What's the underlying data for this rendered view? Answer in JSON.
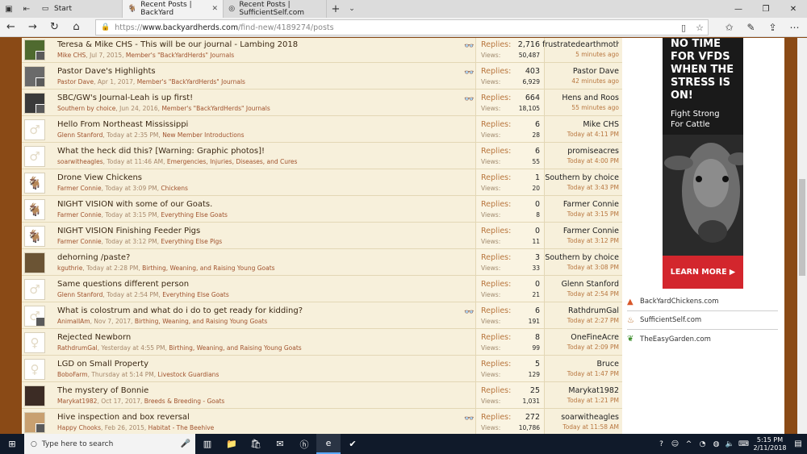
{
  "browser": {
    "tabs": [
      {
        "label": "Start",
        "state": "start"
      },
      {
        "label": "Recent Posts | BackYard",
        "state": "active"
      },
      {
        "label": "Recent Posts | SufficientSelf.com",
        "state": "inactive"
      }
    ],
    "url": {
      "prefix": "https://",
      "domain": "www.backyardherds.com",
      "path": "/find-new/4189274/posts"
    }
  },
  "labels": {
    "replies": "Replies:",
    "views": "Views:"
  },
  "threads": [
    {
      "title": "Teresa & Mike CHS - This will be our journal - Lambing 2018",
      "author": "Mike CHS",
      "date": "Jul 7, 2015",
      "forum": "Member's \"BackYardHerds\" Journals",
      "replies": "2,716",
      "views": "50,487",
      "last_user": "frustratedearthmother",
      "last_time": "5 minutes ago",
      "avatar": "photo-green",
      "watched": true
    },
    {
      "title": "Pastor Dave's Highlights",
      "author": "Pastor Dave",
      "date": "Apr 1, 2017",
      "forum": "Member's \"BackYardHerds\" Journals",
      "replies": "403",
      "views": "6,929",
      "last_user": "Pastor Dave",
      "last_time": "42 minutes ago",
      "avatar": "photo-gray",
      "watched": true
    },
    {
      "title": "SBC/GW's Journal-Leah is up first!",
      "author": "Southern by choice",
      "date": "Jun 24, 2016",
      "forum": "Member's \"BackYardHerds\" Journals",
      "replies": "664",
      "views": "18,105",
      "last_user": "Hens and Roos",
      "last_time": "55 minutes ago",
      "avatar": "photo-dog",
      "watched": true
    },
    {
      "title": "Hello From Northeast Mississippi",
      "author": "Glenn Stanford",
      "date": "Today at 2:35 PM",
      "forum": "New Member Introductions",
      "replies": "6",
      "views": "28",
      "last_user": "Mike CHS",
      "last_time": "Today at 4:11 PM",
      "avatar": "male",
      "watched": false
    },
    {
      "title": "What the heck did this? [Warning: Graphic photos]!",
      "author": "soarwitheagles",
      "date": "Today at 11:46 AM",
      "forum": "Emergencies, Injuries, Diseases, and Cures",
      "replies": "6",
      "views": "55",
      "last_user": "promiseacres",
      "last_time": "Today at 4:00 PM",
      "avatar": "male",
      "watched": false
    },
    {
      "title": "Drone View Chickens",
      "author": "Farmer Connie",
      "date": "Today at 3:09 PM",
      "forum": "Chickens",
      "replies": "1",
      "views": "20",
      "last_user": "Southern by choice",
      "last_time": "Today at 3:43 PM",
      "avatar": "goat",
      "watched": false
    },
    {
      "title": "NIGHT VISION with some of our Goats.",
      "author": "Farmer Connie",
      "date": "Today at 3:15 PM",
      "forum": "Everything Else Goats",
      "replies": "0",
      "views": "8",
      "last_user": "Farmer Connie",
      "last_time": "Today at 3:15 PM",
      "avatar": "goat",
      "watched": false
    },
    {
      "title": "NIGHT VISION Finishing Feeder Pigs",
      "author": "Farmer Connie",
      "date": "Today at 3:12 PM",
      "forum": "Everything Else Pigs",
      "replies": "0",
      "views": "11",
      "last_user": "Farmer Connie",
      "last_time": "Today at 3:12 PM",
      "avatar": "goat",
      "watched": false
    },
    {
      "title": "dehorning /paste?",
      "author": "kguthrie",
      "date": "Today at 2:28 PM",
      "forum": "Birthing, Weaning, and Raising Young Goats",
      "replies": "3",
      "views": "33",
      "last_user": "Southern by choice",
      "last_time": "Today at 3:08 PM",
      "avatar": "photo-brown",
      "watched": false
    },
    {
      "title": "Same questions different person",
      "author": "Glenn Stanford",
      "date": "Today at 2:54 PM",
      "forum": "Everything Else Goats",
      "replies": "0",
      "views": "21",
      "last_user": "Glenn Stanford",
      "last_time": "Today at 2:54 PM",
      "avatar": "male",
      "watched": false
    },
    {
      "title": "What is colostrum and what do i do to get ready for kidding?",
      "author": "AnimalIAm",
      "date": "Nov 7, 2017",
      "forum": "Birthing, Weaning, and Raising Young Goats",
      "replies": "6",
      "views": "191",
      "last_user": "RathdrumGal",
      "last_time": "Today at 2:27 PM",
      "avatar": "male-mini",
      "watched": true
    },
    {
      "title": "Rejected Newborn",
      "author": "RathdrumGal",
      "date": "Yesterday at 4:55 PM",
      "forum": "Birthing, Weaning, and Raising Young Goats",
      "replies": "8",
      "views": "99",
      "last_user": "OneFineAcre",
      "last_time": "Today at 2:09 PM",
      "avatar": "female",
      "watched": false
    },
    {
      "title": "LGD on Small Property",
      "author": "BoboFarm",
      "date": "Thursday at 5:14 PM",
      "forum": "Livestock Guardians",
      "replies": "5",
      "views": "129",
      "last_user": "Bruce",
      "last_time": "Today at 1:47 PM",
      "avatar": "female",
      "watched": false
    },
    {
      "title": "The mystery of Bonnie",
      "author": "Marykat1982",
      "date": "Oct 17, 2017",
      "forum": "Breeds & Breeding - Goats",
      "replies": "25",
      "views": "1,031",
      "last_user": "Marykat1982",
      "last_time": "Today at 1:21 PM",
      "avatar": "photo-person",
      "watched": false
    },
    {
      "title": "Hive inspection and box reversal",
      "author": "Happy Chooks",
      "date": "Feb 26, 2015",
      "forum": "Habitat - The Beehive",
      "replies": "272",
      "views": "10,786",
      "last_user": "soarwitheagles",
      "last_time": "Today at 11:58 AM",
      "avatar": "photo-tan",
      "watched": true
    }
  ],
  "ad": {
    "headline": "NO TIME FOR VFDS WHEN THE STRESS IS ON!",
    "sub1": "Fight Strong",
    "sub2": "For Cattle",
    "cta": "LEARN MORE ▶"
  },
  "sister_sites": [
    {
      "label": "BackYardChickens.com",
      "icon": "chicken-icon"
    },
    {
      "label": "SufficientSelf.com",
      "icon": "flame-icon"
    },
    {
      "label": "TheEasyGarden.com",
      "icon": "leaf-icon"
    }
  ],
  "taskbar": {
    "search_placeholder": "Type here to search",
    "time": "5:15 PM",
    "date": "2/11/2018"
  }
}
